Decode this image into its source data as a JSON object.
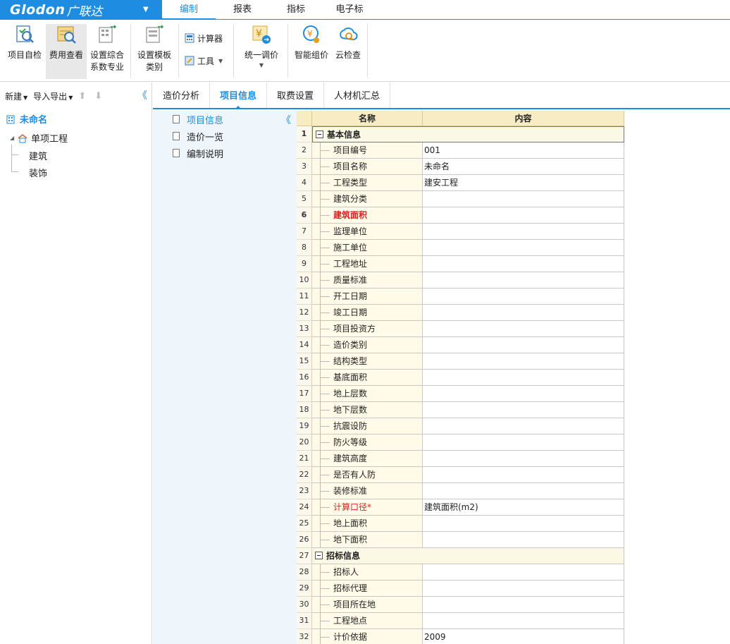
{
  "brand": {
    "logo": "Glodon",
    "logo_cn": "广联达"
  },
  "menu": {
    "items": [
      "编制",
      "报表",
      "指标",
      "电子标"
    ],
    "active": "编制"
  },
  "ribbon": {
    "project_check": "项目自检",
    "fee_view": "费用查看",
    "set_coef_1": "设置综合",
    "set_coef_2": "系数专业",
    "set_template_1": "设置模板",
    "set_template_2": "类别",
    "calculator": "计算器",
    "tools": "工具",
    "unify_price": "统一调价",
    "smart_price": "智能组价",
    "cloud_check": "云检查"
  },
  "left": {
    "new": "新建",
    "import_export": "导入导出",
    "root": "未命名",
    "unit": "单项工程",
    "children": [
      "建筑",
      "装饰"
    ]
  },
  "tabs": [
    "造价分析",
    "项目信息",
    "取费设置",
    "人材机汇总"
  ],
  "mid_nav": [
    "项目信息",
    "造价一览",
    "编制说明"
  ],
  "grid": {
    "headers": {
      "name": "名称",
      "content": "内容"
    },
    "rows": [
      {
        "n": "1",
        "name": "基本信息",
        "value": "",
        "group": true
      },
      {
        "n": "2",
        "name": "项目编号",
        "value": "001"
      },
      {
        "n": "3",
        "name": "项目名称",
        "value": "未命名"
      },
      {
        "n": "4",
        "name": "工程类型",
        "value": "建安工程"
      },
      {
        "n": "5",
        "name": "建筑分类",
        "value": ""
      },
      {
        "n": "6",
        "name": "建筑面积",
        "value": "",
        "style": "red"
      },
      {
        "n": "7",
        "name": "监理单位",
        "value": ""
      },
      {
        "n": "8",
        "name": "施工单位",
        "value": ""
      },
      {
        "n": "9",
        "name": "工程地址",
        "value": ""
      },
      {
        "n": "10",
        "name": "质量标准",
        "value": ""
      },
      {
        "n": "11",
        "name": "开工日期",
        "value": ""
      },
      {
        "n": "12",
        "name": "竣工日期",
        "value": ""
      },
      {
        "n": "13",
        "name": "项目投资方",
        "value": ""
      },
      {
        "n": "14",
        "name": "造价类别",
        "value": ""
      },
      {
        "n": "15",
        "name": "结构类型",
        "value": ""
      },
      {
        "n": "16",
        "name": "基底面积",
        "value": ""
      },
      {
        "n": "17",
        "name": "地上层数",
        "value": ""
      },
      {
        "n": "18",
        "name": "地下层数",
        "value": ""
      },
      {
        "n": "19",
        "name": "抗震设防",
        "value": ""
      },
      {
        "n": "20",
        "name": "防火等级",
        "value": ""
      },
      {
        "n": "21",
        "name": "建筑高度",
        "value": ""
      },
      {
        "n": "22",
        "name": "是否有人防",
        "value": ""
      },
      {
        "n": "23",
        "name": "装修标准",
        "value": ""
      },
      {
        "n": "24",
        "name": "计算口径*",
        "value": "建筑面积(m2)",
        "style": "redlight"
      },
      {
        "n": "25",
        "name": "地上面积",
        "value": ""
      },
      {
        "n": "26",
        "name": "地下面积",
        "value": ""
      },
      {
        "n": "27",
        "name": "招标信息",
        "value": "",
        "group": true
      },
      {
        "n": "28",
        "name": "招标人",
        "value": ""
      },
      {
        "n": "29",
        "name": "招标代理",
        "value": ""
      },
      {
        "n": "30",
        "name": "项目所在地",
        "value": ""
      },
      {
        "n": "31",
        "name": "工程地点",
        "value": ""
      },
      {
        "n": "32",
        "name": "计价依据",
        "value": "2009"
      }
    ]
  },
  "colors": {
    "accent": "#1e8ce0",
    "brand_bg": "#1e8ce0",
    "required": "#e02020",
    "header_bg": "#f7ecc4"
  }
}
